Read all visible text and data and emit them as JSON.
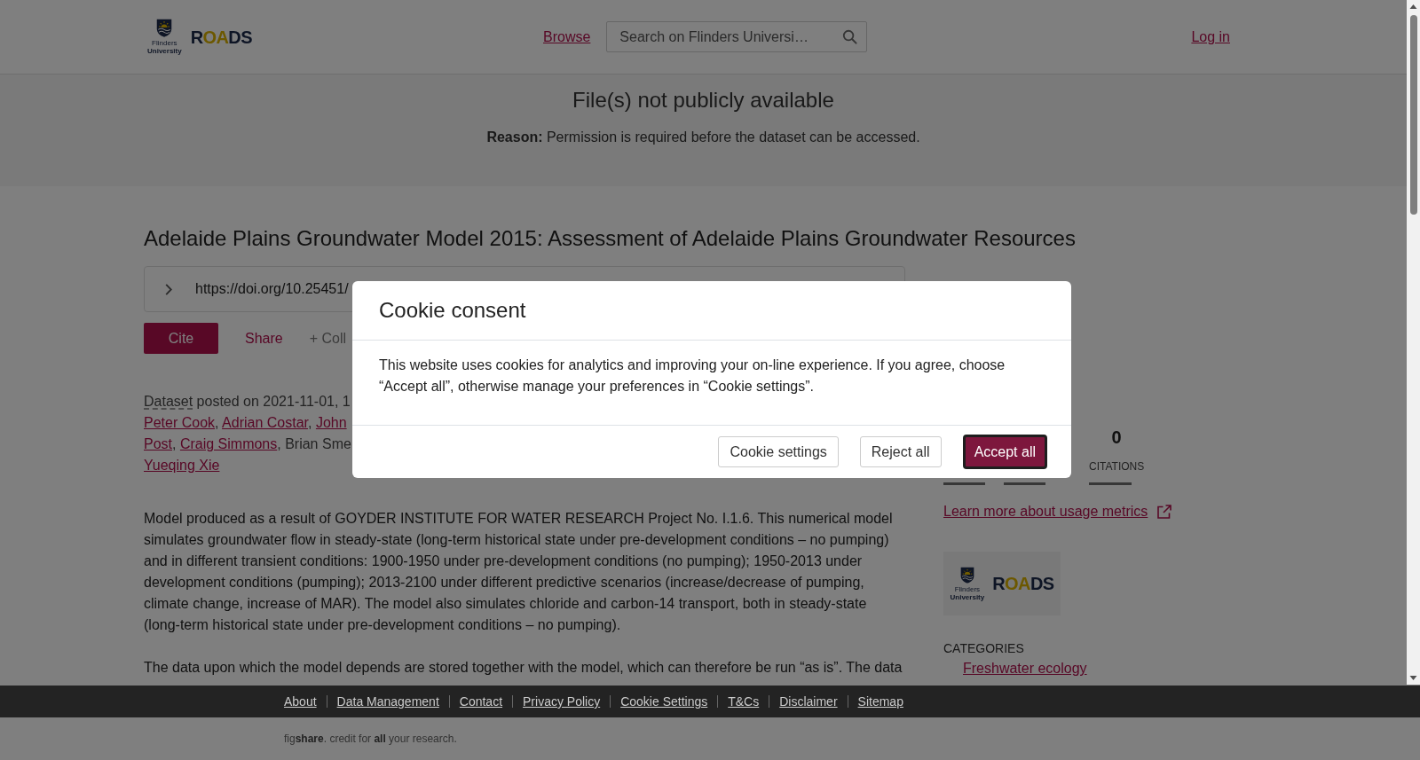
{
  "header": {
    "logo": {
      "university": "Flinders **University**",
      "repository": "ROADS"
    },
    "nav": [
      {
        "label": "Browse"
      }
    ],
    "search": {
      "placeholder": "Search on Flinders Universi…"
    },
    "login": "Log in"
  },
  "notice": {
    "title": "File(s) not publicly available",
    "reason": "**Reason:** Permission is required before the dataset can be accessed."
  },
  "record": {
    "title": "Adelaide Plains Groundwater Model 2015: Assessment of Adelaide Plains Groundwater Resources",
    "doi": "https://doi.org/10.25451/",
    "actions": [
      {
        "label": "Cite",
        "kind": "primary"
      },
      {
        "label": "Share",
        "kind": "link"
      },
      {
        "label": "+ Coll",
        "kind": "muted"
      }
    ],
    "byline": [
      [
        {
          "kind": "term",
          "text": "Dataset"
        },
        {
          "kind": "text",
          "text": " posted on 2021-11-01, 1"
        }
      ],
      [
        {
          "kind": "link",
          "text": "Peter Cook"
        },
        {
          "kind": "text",
          "text": ", "
        },
        {
          "kind": "link",
          "text": "Adrian Costar"
        },
        {
          "kind": "text",
          "text": ", "
        },
        {
          "kind": "link",
          "text": "John"
        }
      ],
      [
        {
          "kind": "link",
          "text": "Post"
        },
        {
          "kind": "text",
          "text": ", "
        },
        {
          "kind": "link",
          "text": "Craig Simmons"
        },
        {
          "kind": "text",
          "text": ", Brian Sme"
        }
      ],
      [
        {
          "kind": "link",
          "text": "Yueqing Xie"
        }
      ]
    ],
    "description": [
      "Model produced as a result of GOYDER INSTITUTE FOR WATER RESEARCH Project No. I.1.6. This numerical model simulates groundwater flow in steady-state (long-term historical state under pre-development conditions – no pumping) and in different transient conditions: 1900-1950 under pre-development conditions (no pumping); 1950-2013 under development conditions (pumping); 2013-2100 under different predictive scenarios (increase/decrease of pumping, climate change, increase of MAR). The model also simulates chloride and carbon-14 transport, both in steady-state (long-term historical state under pre-development conditions – no pumping).",
      "The data upon which the model depends are stored together with the model, which can therefore be run “as is”. The data"
    ]
  },
  "sidebar": {
    "metrics": [
      {
        "value": "0",
        "label": "CITATIONS"
      }
    ],
    "metrics_link": "Learn more about usage metrics",
    "logo": {
      "university": "Flinders **University**",
      "repository": "ROADS"
    },
    "categories": {
      "heading": "CATEGORIES",
      "items": [
        "Freshwater ecology"
      ]
    }
  },
  "footer": {
    "links": [
      "About",
      "Data Management",
      "Contact",
      "Privacy Policy",
      "Cookie Settings",
      "T&Cs",
      "Disclaimer",
      "Sitemap"
    ],
    "tagline": "fig**share**. credit for **all** your research."
  },
  "cookie_dialog": {
    "title": "Cookie consent",
    "message": "This website uses cookies for analytics and improving your on-line experience. If you agree, choose “Accept all”, otherwise manage your preferences in “Cookie settings”.",
    "buttons": [
      {
        "label": "Cookie settings",
        "kind": "secondary",
        "focused": false
      },
      {
        "label": "Reject all",
        "kind": "secondary",
        "focused": false
      },
      {
        "label": "Accept all",
        "kind": "primary",
        "focused": true
      }
    ]
  }
}
